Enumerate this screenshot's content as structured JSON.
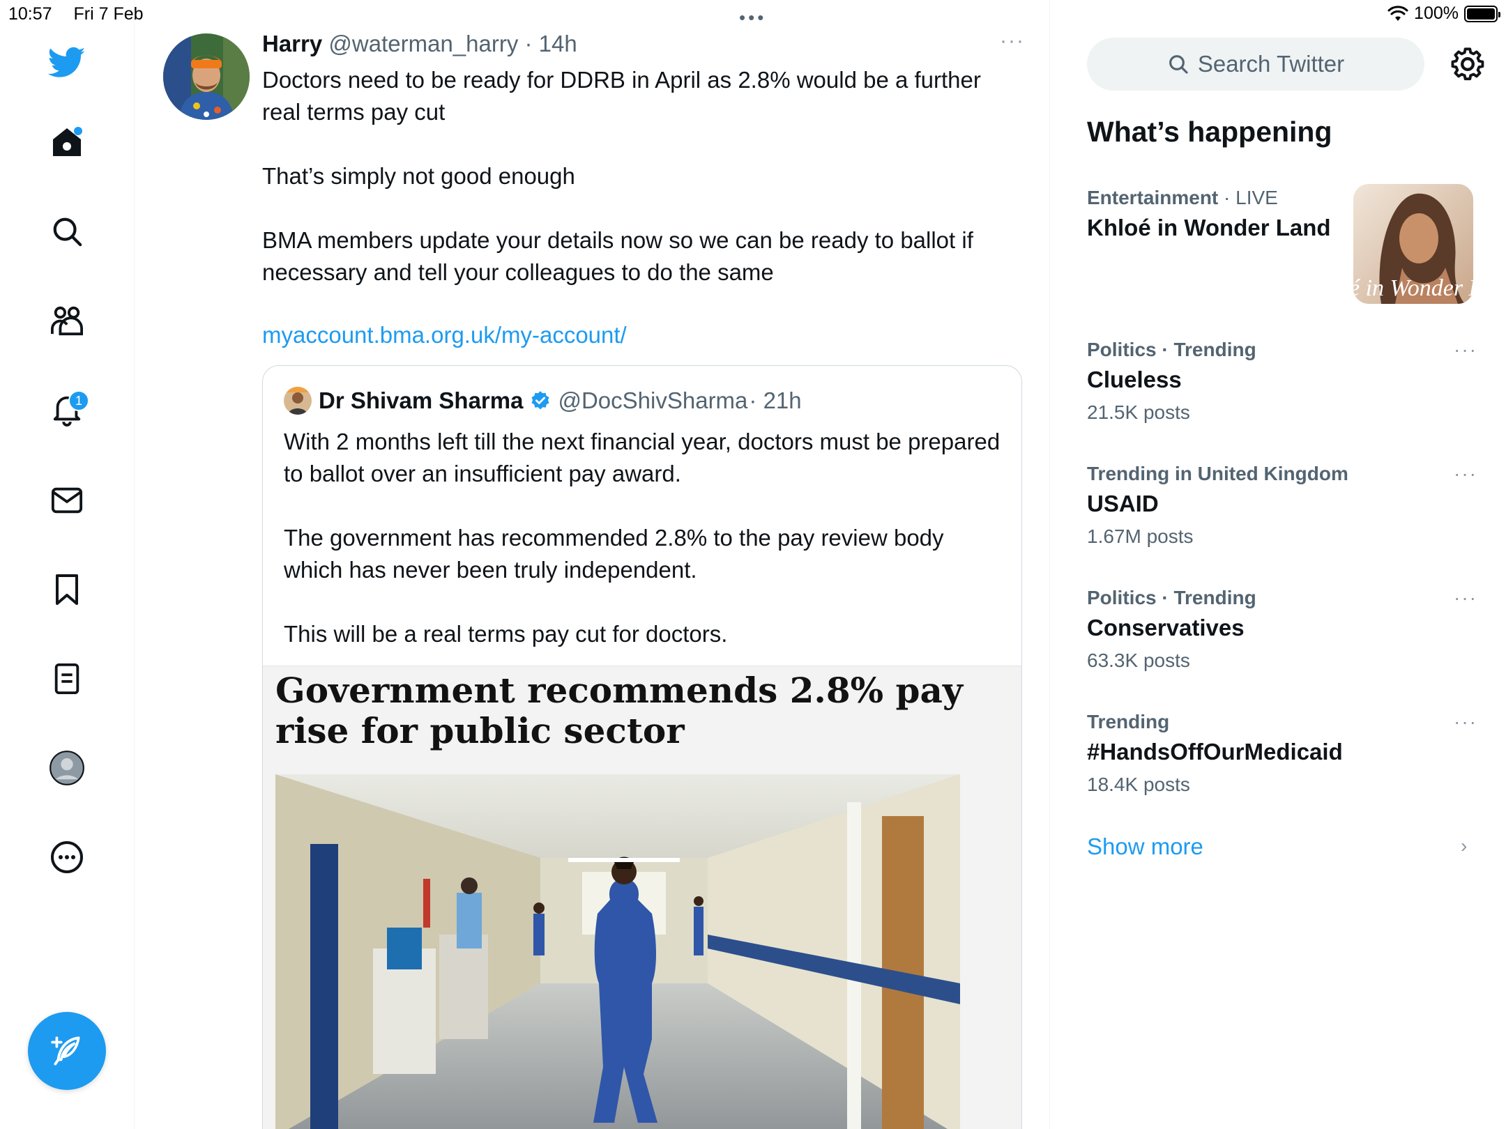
{
  "status_bar": {
    "time": "10:57",
    "date": "Fri 7 Feb",
    "dots": "•••",
    "battery": "100%"
  },
  "nav": {
    "items": [
      "home",
      "explore",
      "communities",
      "notifications",
      "messages",
      "bookmarks",
      "lists",
      "profile",
      "more"
    ],
    "notification_count": "1",
    "accent_color": "#1d9bf0"
  },
  "tweet": {
    "name": "Harry",
    "handle": "@waterman_harry",
    "time": "· 14h",
    "more": "···",
    "text": "Doctors need to be ready for DDRB in April as 2.8% would be a further real terms pay cut\n\nThat’s simply not good enough\n\nBMA members update your details now so we can be ready to ballot if necessary and tell your colleagues to do the same",
    "link": "myaccount.bma.org.uk/my-account/",
    "quote": {
      "name": "Dr Shivam Sharma",
      "handle": "@DocShivSharma",
      "time": "· 21h",
      "text": "With 2 months left till the next financial year, doctors must be prepared to ballot over an insufficient pay award.\n\nThe government has recommended 2.8% to the pay review body which has never been truly independent.\n\nThis will be a real terms pay cut for doctors.",
      "headline": "Government recommends 2.8% pay rise for public sector"
    }
  },
  "sidebar": {
    "search_placeholder": "Search Twitter",
    "section_title": "What’s happening",
    "trends": [
      {
        "category": "Entertainment",
        "category_extra": " · LIVE",
        "title": "Khloé in Wonder Land",
        "posts": ""
      },
      {
        "category": "Politics · Trending",
        "category_extra": "",
        "title": "Clueless",
        "posts": "21.5K posts"
      },
      {
        "category": "Trending in United Kingdom",
        "category_extra": "",
        "title": "USAID",
        "posts": "1.67M posts"
      },
      {
        "category": "Politics · Trending",
        "category_extra": "",
        "title": "Conservatives",
        "posts": "63.3K posts"
      },
      {
        "category": "Trending",
        "category_extra": "",
        "title": "#HandsOffOurMedicaid",
        "posts": "18.4K posts"
      }
    ],
    "trend_thumb_text": "é in Wonder L",
    "more": "···",
    "show_more": "Show more",
    "chevron": "›"
  }
}
